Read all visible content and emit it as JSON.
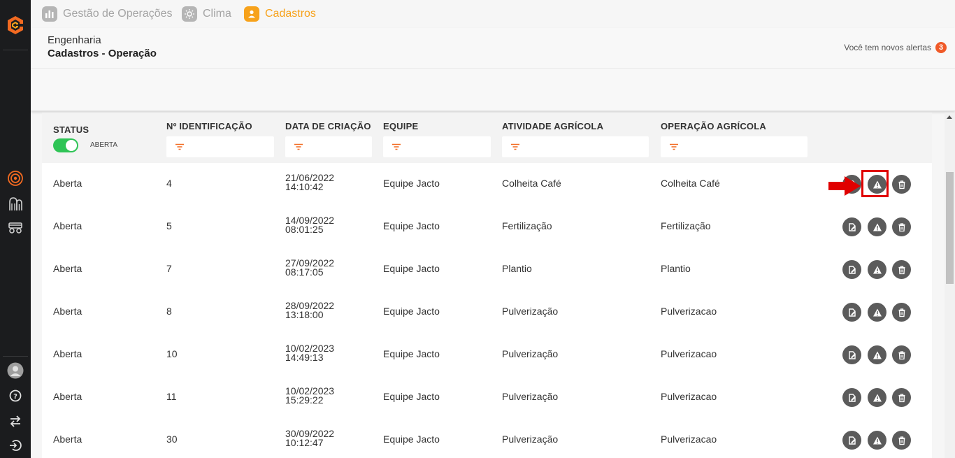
{
  "nav": {
    "tabs": [
      {
        "label": "Gestão de Operações",
        "icon": "operations-chart-icon"
      },
      {
        "label": "Clima",
        "icon": "sun-icon"
      },
      {
        "label": "Cadastros",
        "icon": "user-icon"
      }
    ],
    "active_tab": "Cadastros"
  },
  "header": {
    "breadcrumb": "Engenharia",
    "title": "Cadastros - Operação",
    "alerts_text": "Você tem novos alertas",
    "alerts_count": "3"
  },
  "table": {
    "columns": [
      "STATUS",
      "Nº IDENTIFICAÇÃO",
      "DATA DE CRIAÇÃO",
      "EQUIPE",
      "ATIVIDADE AGRÍCOLA",
      "OPERAÇÃO AGRÍCOLA"
    ],
    "status_filter": {
      "label": "ABERTA",
      "enabled": true
    },
    "rows": [
      {
        "status": "Aberta",
        "id": "4",
        "date": "21/06/2022",
        "time": "14:10:42",
        "team": "Equipe Jacto",
        "activity": "Colheita Café",
        "operation": "Colheita Café"
      },
      {
        "status": "Aberta",
        "id": "5",
        "date": "14/09/2022",
        "time": "08:01:25",
        "team": "Equipe Jacto",
        "activity": "Fertilização",
        "operation": "Fertilização"
      },
      {
        "status": "Aberta",
        "id": "7",
        "date": "27/09/2022",
        "time": "08:17:05",
        "team": "Equipe Jacto",
        "activity": "Plantio",
        "operation": "Plantio"
      },
      {
        "status": "Aberta",
        "id": "8",
        "date": "28/09/2022",
        "time": "13:18:00",
        "team": "Equipe Jacto",
        "activity": "Pulverização",
        "operation": "Pulverizacao"
      },
      {
        "status": "Aberta",
        "id": "10",
        "date": "10/02/2023",
        "time": "14:49:13",
        "team": "Equipe Jacto",
        "activity": "Pulverização",
        "operation": "Pulverizacao"
      },
      {
        "status": "Aberta",
        "id": "11",
        "date": "10/02/2023",
        "time": "15:29:22",
        "team": "Equipe Jacto",
        "activity": "Pulverização",
        "operation": "Pulverizacao"
      },
      {
        "status": "Aberta",
        "id": "30",
        "date": "30/09/2022",
        "time": "10:12:47",
        "team": "Equipe Jacto",
        "activity": "Pulverização",
        "operation": "Pulverizacao"
      }
    ],
    "row_actions": [
      "edit-icon",
      "alert-triangle-icon",
      "trash-icon"
    ]
  },
  "colors": {
    "accent": "#f7a21b",
    "toggle_on": "#2fc456",
    "badge": "#f05a28",
    "annotation": "#e00000",
    "sidebar": "#1b1c1e"
  }
}
